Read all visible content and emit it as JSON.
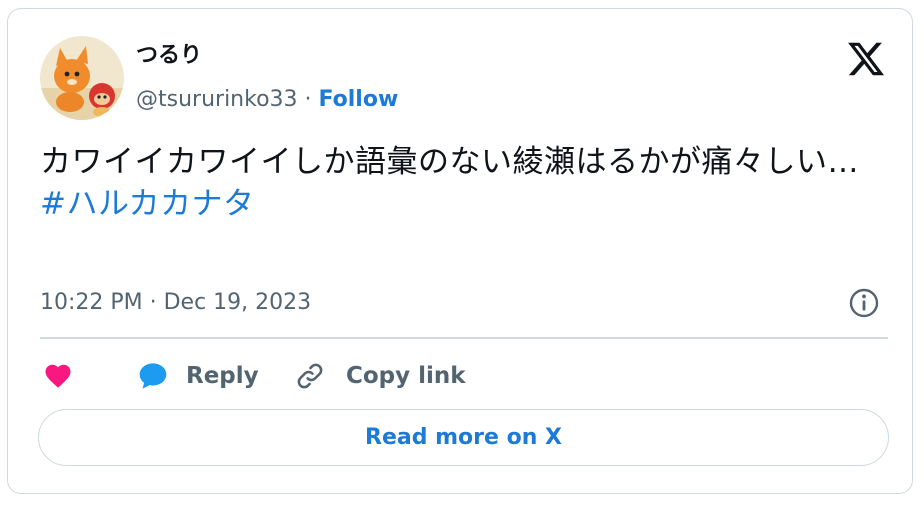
{
  "tweet": {
    "display_name": "つるり",
    "handle": "@tsururinko33",
    "separator": " · ",
    "follow_label": "Follow",
    "text": "カワイイカワイイしか語彙のない綾瀬はるかが痛々しい…",
    "hashtag": "#ハルカカナタ",
    "timestamp": "10:22 PM · Dec 19, 2023"
  },
  "actions": {
    "like_icon": "heart-icon",
    "reply_label": "Reply",
    "reply_icon": "speech-bubble-icon",
    "copy_label": "Copy link",
    "copy_icon": "link-icon"
  },
  "footer": {
    "read_more_label": "Read more on X"
  },
  "colors": {
    "accent": "#1d7ad6",
    "like": "#f91880",
    "reply_icon": "#1d9bf0",
    "muted_text": "#536471",
    "border": "#cfd9de"
  }
}
